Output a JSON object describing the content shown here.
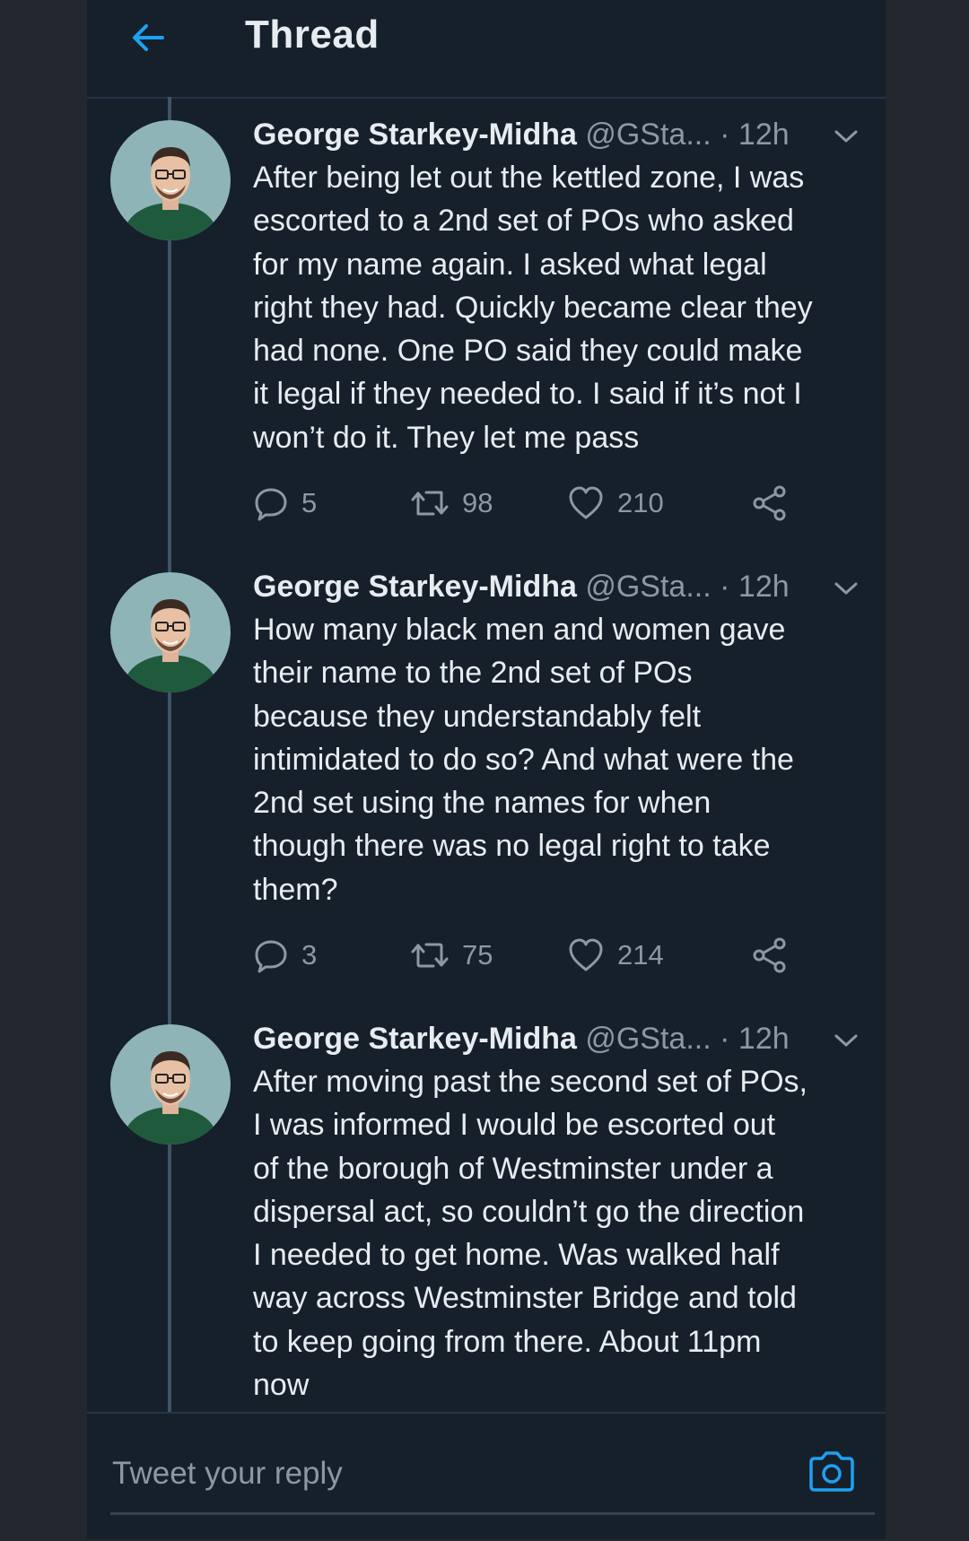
{
  "header": {
    "title": "Thread"
  },
  "tweets": [
    {
      "name": "George Starkey-Midha",
      "handle": "@GSta...",
      "separator": "·",
      "time": "12h",
      "text": "After being let out the kettled zone, I was\nescorted to a 2nd set of POs who asked\nfor my name again. I asked what legal\nright they had. Quickly became clear they\nhad none. One PO said they could make\nit legal if they needed to. I said if it’s not I\nwon’t do it. They let me pass",
      "replies": "5",
      "retweets": "98",
      "likes": "210"
    },
    {
      "name": "George Starkey-Midha",
      "handle": "@GSta...",
      "separator": "·",
      "time": "12h",
      "text": "How many black men and women gave\ntheir name to the 2nd set of POs\nbecause they understandably felt\nintimidated to do so? And what were the\n2nd set using the names for when\nthough there was no legal right to take\nthem?",
      "replies": "3",
      "retweets": "75",
      "likes": "214"
    },
    {
      "name": "George Starkey-Midha",
      "handle": "@GSta...",
      "separator": "·",
      "time": "12h",
      "text": "After moving past the second set of POs,\nI was informed I would be escorted out\nof the borough of Westminster under a\ndispersal act, so couldn’t go the direction\nI needed to get home. Was walked half\nway across Westminster Bridge and told\nto keep going from there. About 11pm\nnow"
    }
  ],
  "reply_bar": {
    "placeholder": "Tweet your reply"
  },
  "colors": {
    "background": "#15202b",
    "accent": "#1da1f2",
    "text_primary": "#e7ecf0",
    "text_secondary": "#8b98a5"
  },
  "icons": {
    "back": "arrow-left-icon",
    "caret": "chevron-down-icon",
    "reply": "reply-icon",
    "retweet": "retweet-icon",
    "like": "heart-icon",
    "share": "share-icon",
    "camera": "camera-icon"
  }
}
